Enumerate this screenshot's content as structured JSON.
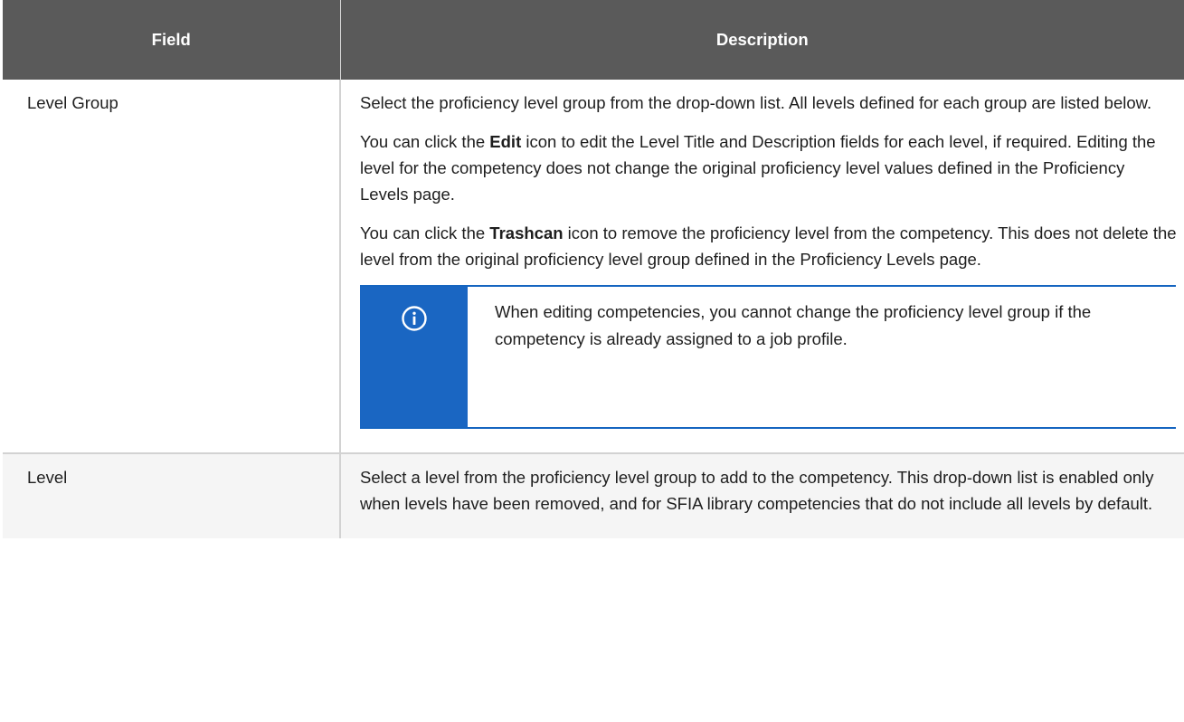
{
  "table": {
    "headers": [
      "Field",
      "Description"
    ],
    "rows": [
      {
        "field": "Level Group",
        "paragraphs": [
          {
            "text": "Select the proficiency level group from the drop-down list. All levels defined for each group are listed below."
          },
          {
            "before": "You can click the ",
            "bold": "Edit",
            "after": " icon to edit the Level Title and Description fields for each level, if required. Editing the level for the competency does not change the original proficiency level values defined in the Proficiency Levels page."
          },
          {
            "before": "You can click the ",
            "bold": "Trashcan",
            "after": " icon to remove the proficiency level from the competency. This does not delete the level from the original proficiency level group defined in the Proficiency Levels page."
          }
        ],
        "note": {
          "icon": "info-circle-icon",
          "text": "When editing competencies, you cannot change the proficiency level group if the competency is already assigned to a job profile."
        }
      },
      {
        "field": "Level",
        "paragraphs": [
          {
            "text": "Select a level from the proficiency level group to add to the competency. This drop-down list is enabled only when levels have been removed, and for SFIA library competencies that do not include all levels by default."
          }
        ]
      }
    ]
  },
  "colors": {
    "header_background": "#5a5a5a",
    "note_accent": "#1a66c2",
    "alt_row_background": "#f5f5f5"
  }
}
